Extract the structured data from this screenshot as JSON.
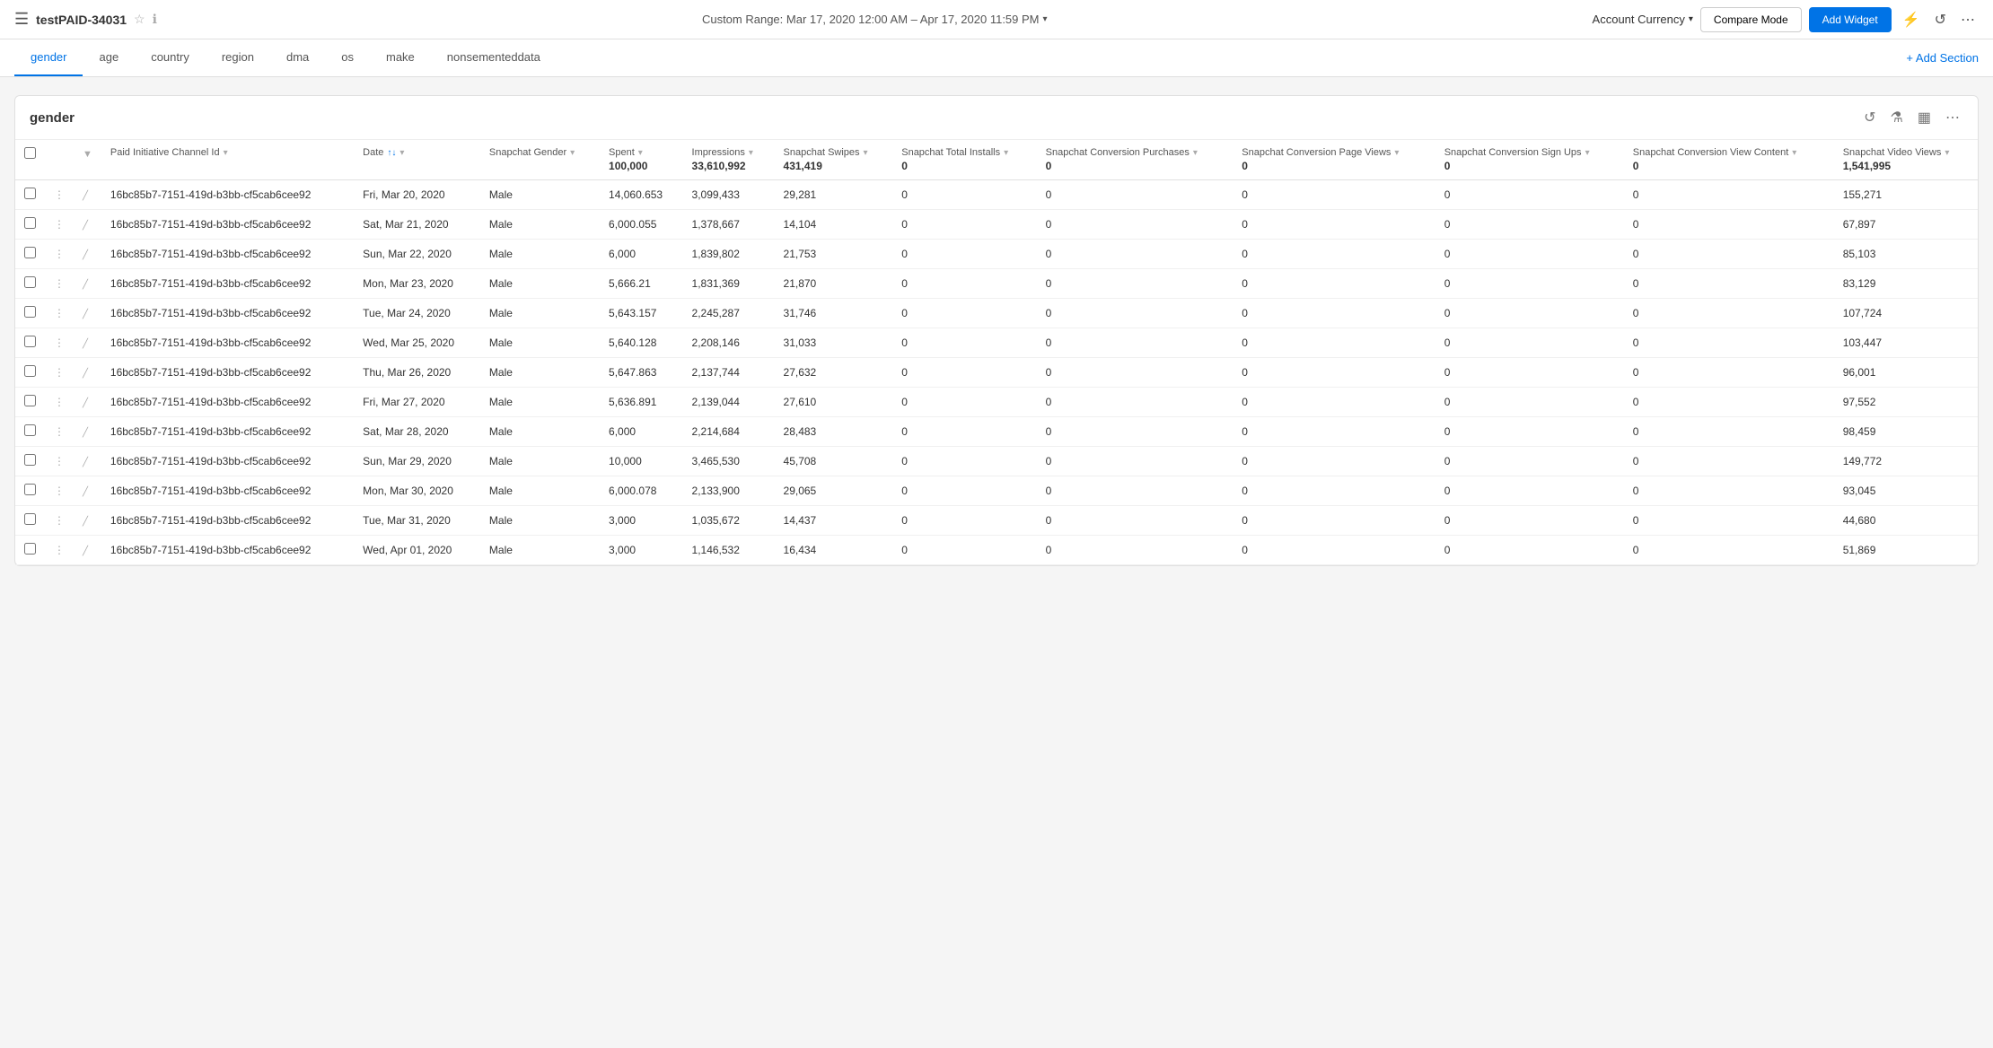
{
  "topbar": {
    "title": "testPAID-34031",
    "date_range": "Custom Range: Mar 17, 2020 12:00 AM – Apr 17, 2020 11:59 PM",
    "account_currency_label": "Account Currency",
    "compare_mode_label": "Compare Mode",
    "add_widget_label": "Add Widget"
  },
  "tabs": [
    {
      "id": "gender",
      "label": "gender",
      "active": true
    },
    {
      "id": "age",
      "label": "age",
      "active": false
    },
    {
      "id": "country",
      "label": "country",
      "active": false
    },
    {
      "id": "region",
      "label": "region",
      "active": false
    },
    {
      "id": "dma",
      "label": "dma",
      "active": false
    },
    {
      "id": "os",
      "label": "os",
      "active": false
    },
    {
      "id": "make",
      "label": "make",
      "active": false
    },
    {
      "id": "nonsementeddata",
      "label": "nonsementeddata",
      "active": false
    }
  ],
  "add_section_label": "+ Add Section",
  "widget": {
    "title": "gender",
    "columns": [
      {
        "key": "channel_id",
        "label": "Paid Initiative Channel Id",
        "agg": ""
      },
      {
        "key": "date",
        "label": "Date",
        "agg": "",
        "sortable": true
      },
      {
        "key": "gender",
        "label": "Snapchat Gender",
        "agg": ""
      },
      {
        "key": "spent",
        "label": "Spent",
        "agg": "100,000"
      },
      {
        "key": "impressions",
        "label": "Impressions",
        "agg": "33,610,992"
      },
      {
        "key": "swipes",
        "label": "Snapchat Swipes",
        "agg": "431,419"
      },
      {
        "key": "total_installs",
        "label": "Snapchat Total Installs",
        "agg": "0"
      },
      {
        "key": "conv_purchases",
        "label": "Snapchat Conversion Purchases",
        "agg": "0"
      },
      {
        "key": "conv_page_views",
        "label": "Snapchat Conversion Page Views",
        "agg": "0"
      },
      {
        "key": "conv_sign_ups",
        "label": "Snapchat Conversion Sign Ups",
        "agg": "0"
      },
      {
        "key": "conv_view_content",
        "label": "Snapchat Conversion View Content",
        "agg": "0"
      },
      {
        "key": "video_views",
        "label": "Snapchat Video Views",
        "agg": "1,541,995"
      }
    ],
    "rows": [
      {
        "channel_id": "16bc85b7-7151-419d-b3bb-cf5cab6cee92",
        "date": "Fri, Mar 20, 2020",
        "gender": "Male",
        "spent": "14,060.653",
        "impressions": "3,099,433",
        "swipes": "29,281",
        "total_installs": "0",
        "conv_purchases": "0",
        "conv_page_views": "0",
        "conv_sign_ups": "0",
        "conv_view_content": "0",
        "video_views": "155,271"
      },
      {
        "channel_id": "16bc85b7-7151-419d-b3bb-cf5cab6cee92",
        "date": "Sat, Mar 21, 2020",
        "gender": "Male",
        "spent": "6,000.055",
        "impressions": "1,378,667",
        "swipes": "14,104",
        "total_installs": "0",
        "conv_purchases": "0",
        "conv_page_views": "0",
        "conv_sign_ups": "0",
        "conv_view_content": "0",
        "video_views": "67,897"
      },
      {
        "channel_id": "16bc85b7-7151-419d-b3bb-cf5cab6cee92",
        "date": "Sun, Mar 22, 2020",
        "gender": "Male",
        "spent": "6,000",
        "impressions": "1,839,802",
        "swipes": "21,753",
        "total_installs": "0",
        "conv_purchases": "0",
        "conv_page_views": "0",
        "conv_sign_ups": "0",
        "conv_view_content": "0",
        "video_views": "85,103"
      },
      {
        "channel_id": "16bc85b7-7151-419d-b3bb-cf5cab6cee92",
        "date": "Mon, Mar 23, 2020",
        "gender": "Male",
        "spent": "5,666.21",
        "impressions": "1,831,369",
        "swipes": "21,870",
        "total_installs": "0",
        "conv_purchases": "0",
        "conv_page_views": "0",
        "conv_sign_ups": "0",
        "conv_view_content": "0",
        "video_views": "83,129"
      },
      {
        "channel_id": "16bc85b7-7151-419d-b3bb-cf5cab6cee92",
        "date": "Tue, Mar 24, 2020",
        "gender": "Male",
        "spent": "5,643.157",
        "impressions": "2,245,287",
        "swipes": "31,746",
        "total_installs": "0",
        "conv_purchases": "0",
        "conv_page_views": "0",
        "conv_sign_ups": "0",
        "conv_view_content": "0",
        "video_views": "107,724"
      },
      {
        "channel_id": "16bc85b7-7151-419d-b3bb-cf5cab6cee92",
        "date": "Wed, Mar 25, 2020",
        "gender": "Male",
        "spent": "5,640.128",
        "impressions": "2,208,146",
        "swipes": "31,033",
        "total_installs": "0",
        "conv_purchases": "0",
        "conv_page_views": "0",
        "conv_sign_ups": "0",
        "conv_view_content": "0",
        "video_views": "103,447"
      },
      {
        "channel_id": "16bc85b7-7151-419d-b3bb-cf5cab6cee92",
        "date": "Thu, Mar 26, 2020",
        "gender": "Male",
        "spent": "5,647.863",
        "impressions": "2,137,744",
        "swipes": "27,632",
        "total_installs": "0",
        "conv_purchases": "0",
        "conv_page_views": "0",
        "conv_sign_ups": "0",
        "conv_view_content": "0",
        "video_views": "96,001"
      },
      {
        "channel_id": "16bc85b7-7151-419d-b3bb-cf5cab6cee92",
        "date": "Fri, Mar 27, 2020",
        "gender": "Male",
        "spent": "5,636.891",
        "impressions": "2,139,044",
        "swipes": "27,610",
        "total_installs": "0",
        "conv_purchases": "0",
        "conv_page_views": "0",
        "conv_sign_ups": "0",
        "conv_view_content": "0",
        "video_views": "97,552"
      },
      {
        "channel_id": "16bc85b7-7151-419d-b3bb-cf5cab6cee92",
        "date": "Sat, Mar 28, 2020",
        "gender": "Male",
        "spent": "6,000",
        "impressions": "2,214,684",
        "swipes": "28,483",
        "total_installs": "0",
        "conv_purchases": "0",
        "conv_page_views": "0",
        "conv_sign_ups": "0",
        "conv_view_content": "0",
        "video_views": "98,459"
      },
      {
        "channel_id": "16bc85b7-7151-419d-b3bb-cf5cab6cee92",
        "date": "Sun, Mar 29, 2020",
        "gender": "Male",
        "spent": "10,000",
        "impressions": "3,465,530",
        "swipes": "45,708",
        "total_installs": "0",
        "conv_purchases": "0",
        "conv_page_views": "0",
        "conv_sign_ups": "0",
        "conv_view_content": "0",
        "video_views": "149,772"
      },
      {
        "channel_id": "16bc85b7-7151-419d-b3bb-cf5cab6cee92",
        "date": "Mon, Mar 30, 2020",
        "gender": "Male",
        "spent": "6,000.078",
        "impressions": "2,133,900",
        "swipes": "29,065",
        "total_installs": "0",
        "conv_purchases": "0",
        "conv_page_views": "0",
        "conv_sign_ups": "0",
        "conv_view_content": "0",
        "video_views": "93,045"
      },
      {
        "channel_id": "16bc85b7-7151-419d-b3bb-cf5cab6cee92",
        "date": "Tue, Mar 31, 2020",
        "gender": "Male",
        "spent": "3,000",
        "impressions": "1,035,672",
        "swipes": "14,437",
        "total_installs": "0",
        "conv_purchases": "0",
        "conv_page_views": "0",
        "conv_sign_ups": "0",
        "conv_view_content": "0",
        "video_views": "44,680"
      },
      {
        "channel_id": "16bc85b7-7151-419d-b3bb-cf5cab6cee92",
        "date": "Wed, Apr 01, 2020",
        "gender": "Male",
        "spent": "3,000",
        "impressions": "1,146,532",
        "swipes": "16,434",
        "total_installs": "0",
        "conv_purchases": "0",
        "conv_page_views": "0",
        "conv_sign_ups": "0",
        "conv_view_content": "0",
        "video_views": "51,869"
      }
    ]
  }
}
